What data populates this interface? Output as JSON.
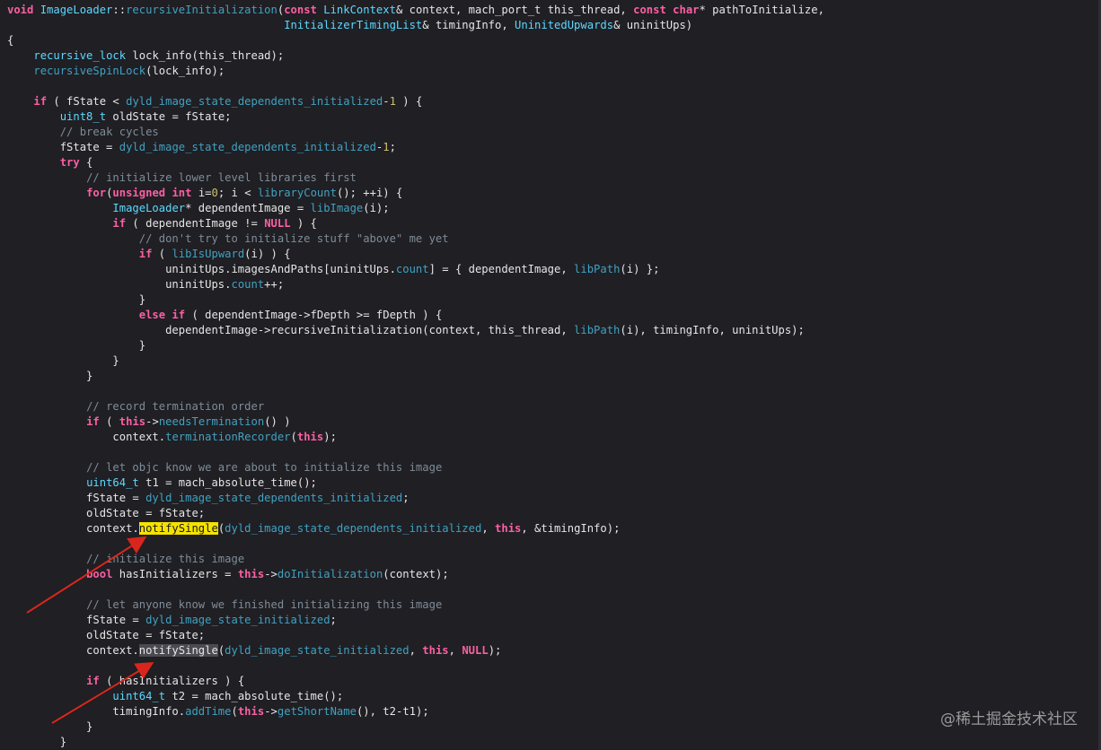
{
  "code_lines": [
    [
      [
        "void ",
        "kw"
      ],
      [
        "ImageLoader",
        "ty"
      ],
      [
        "::",
        "t"
      ],
      [
        "recursiveInitialization",
        "fn"
      ],
      [
        "(",
        "t"
      ],
      [
        "const ",
        "kw"
      ],
      [
        "LinkContext",
        "ty"
      ],
      [
        "& context, mach_port_t this_thread, ",
        "t"
      ],
      [
        "const ",
        "kw"
      ],
      [
        "char",
        "kw"
      ],
      [
        "* pathToInitialize,",
        "t"
      ]
    ],
    [
      [
        "                                          ",
        "t"
      ],
      [
        "InitializerTimingList",
        "ty"
      ],
      [
        "& timingInfo, ",
        "t"
      ],
      [
        "UninitedUpwards",
        "ty"
      ],
      [
        "& uninitUps)",
        "t"
      ]
    ],
    [
      [
        "{",
        "t"
      ]
    ],
    [
      [
        "    ",
        "t"
      ],
      [
        "recursive_lock",
        "ty"
      ],
      [
        " lock_info(this_thread);",
        "t"
      ]
    ],
    [
      [
        "    ",
        "t"
      ],
      [
        "recursiveSpinLock",
        "fn"
      ],
      [
        "(lock_info);",
        "t"
      ]
    ],
    [
      [
        "",
        "t"
      ]
    ],
    [
      [
        "    ",
        "t"
      ],
      [
        "if",
        "kw"
      ],
      [
        " ( fState < ",
        "t"
      ],
      [
        "dyld_image_state_dependents_initialized",
        "fn"
      ],
      [
        "-",
        "t"
      ],
      [
        "1",
        "nm"
      ],
      [
        " ) {",
        "t"
      ]
    ],
    [
      [
        "        ",
        "t"
      ],
      [
        "uint8_t",
        "ty"
      ],
      [
        " oldState = fState;",
        "t"
      ]
    ],
    [
      [
        "        ",
        "t"
      ],
      [
        "// break cycles",
        "cm"
      ]
    ],
    [
      [
        "        fState = ",
        "t"
      ],
      [
        "dyld_image_state_dependents_initialized",
        "fn"
      ],
      [
        "-",
        "t"
      ],
      [
        "1",
        "nm"
      ],
      [
        ";",
        "t"
      ]
    ],
    [
      [
        "        ",
        "t"
      ],
      [
        "try",
        "kw"
      ],
      [
        " {",
        "t"
      ]
    ],
    [
      [
        "            ",
        "t"
      ],
      [
        "// initialize lower level libraries first",
        "cm"
      ]
    ],
    [
      [
        "            ",
        "t"
      ],
      [
        "for",
        "kw"
      ],
      [
        "(",
        "t"
      ],
      [
        "unsigned int",
        "kw"
      ],
      [
        " i=",
        "t"
      ],
      [
        "0",
        "nm"
      ],
      [
        "; i < ",
        "t"
      ],
      [
        "libraryCount",
        "fn"
      ],
      [
        "(); ++i) {",
        "t"
      ]
    ],
    [
      [
        "                ",
        "t"
      ],
      [
        "ImageLoader",
        "ty"
      ],
      [
        "* dependentImage = ",
        "t"
      ],
      [
        "libImage",
        "fn"
      ],
      [
        "(i);",
        "t"
      ]
    ],
    [
      [
        "                ",
        "t"
      ],
      [
        "if",
        "kw"
      ],
      [
        " ( dependentImage != ",
        "t"
      ],
      [
        "NULL",
        "kw"
      ],
      [
        " ) {",
        "t"
      ]
    ],
    [
      [
        "                    ",
        "t"
      ],
      [
        "// don't try to initialize stuff \"above\" me yet",
        "cm"
      ]
    ],
    [
      [
        "                    ",
        "t"
      ],
      [
        "if",
        "kw"
      ],
      [
        " ( ",
        "t"
      ],
      [
        "libIsUpward",
        "fn"
      ],
      [
        "(i) ) {",
        "t"
      ]
    ],
    [
      [
        "                        uninitUps.imagesAndPaths[uninitUps.",
        "t"
      ],
      [
        "count",
        "fn"
      ],
      [
        "] = { dependentImage, ",
        "t"
      ],
      [
        "libPath",
        "fn"
      ],
      [
        "(i) };",
        "t"
      ]
    ],
    [
      [
        "                        uninitUps.",
        "t"
      ],
      [
        "count",
        "fn"
      ],
      [
        "++;",
        "t"
      ]
    ],
    [
      [
        "                    }",
        "t"
      ]
    ],
    [
      [
        "                    ",
        "t"
      ],
      [
        "else if",
        "kw"
      ],
      [
        " ( dependentImage->fDepth >= fDepth ) {",
        "t"
      ]
    ],
    [
      [
        "                        dependentImage->recursiveInitialization(context, this_thread, ",
        "t"
      ],
      [
        "libPath",
        "fn"
      ],
      [
        "(i), timingInfo, uninitUps);",
        "t"
      ]
    ],
    [
      [
        "                    }",
        "t"
      ]
    ],
    [
      [
        "                }",
        "t"
      ]
    ],
    [
      [
        "            }",
        "t"
      ]
    ],
    [
      [
        "",
        "t"
      ]
    ],
    [
      [
        "            ",
        "t"
      ],
      [
        "// record termination order",
        "cm"
      ]
    ],
    [
      [
        "            ",
        "t"
      ],
      [
        "if",
        "kw"
      ],
      [
        " ( ",
        "t"
      ],
      [
        "this",
        "kw"
      ],
      [
        "->",
        "t"
      ],
      [
        "needsTermination",
        "fn"
      ],
      [
        "() )",
        "t"
      ]
    ],
    [
      [
        "                context.",
        "t"
      ],
      [
        "terminationRecorder",
        "fn"
      ],
      [
        "(",
        "t"
      ],
      [
        "this",
        "kw"
      ],
      [
        ");",
        "t"
      ]
    ],
    [
      [
        "",
        "t"
      ]
    ],
    [
      [
        "            ",
        "t"
      ],
      [
        "// let objc know we are about to initialize this image",
        "cm"
      ]
    ],
    [
      [
        "            ",
        "t"
      ],
      [
        "uint64_t",
        "ty"
      ],
      [
        " t1 = mach_absolute_time();",
        "t"
      ]
    ],
    [
      [
        "            fState = ",
        "t"
      ],
      [
        "dyld_image_state_dependents_initialized",
        "fn"
      ],
      [
        ";",
        "t"
      ]
    ],
    [
      [
        "            oldState = fState;",
        "t"
      ]
    ],
    [
      [
        "            context.",
        "t"
      ],
      [
        "notifySingle",
        "hl-yellow"
      ],
      [
        "(",
        "t"
      ],
      [
        "dyld_image_state_dependents_initialized",
        "fn"
      ],
      [
        ", ",
        "t"
      ],
      [
        "this",
        "kw"
      ],
      [
        ", &timingInfo);",
        "t"
      ]
    ],
    [
      [
        "",
        "t"
      ]
    ],
    [
      [
        "            ",
        "t"
      ],
      [
        "// initialize this image",
        "cm"
      ]
    ],
    [
      [
        "            ",
        "t"
      ],
      [
        "bool",
        "kw"
      ],
      [
        " hasInitializers = ",
        "t"
      ],
      [
        "this",
        "kw"
      ],
      [
        "->",
        "t"
      ],
      [
        "doInitialization",
        "fn"
      ],
      [
        "(context);",
        "t"
      ]
    ],
    [
      [
        "",
        "t"
      ]
    ],
    [
      [
        "            ",
        "t"
      ],
      [
        "// let anyone know we finished initializing this image",
        "cm"
      ]
    ],
    [
      [
        "            fState = ",
        "t"
      ],
      [
        "dyld_image_state_initialized",
        "fn"
      ],
      [
        ";",
        "t"
      ]
    ],
    [
      [
        "            oldState = fState;",
        "t"
      ]
    ],
    [
      [
        "            context.",
        "t"
      ],
      [
        "notifySingle",
        "hl-gray"
      ],
      [
        "(",
        "t"
      ],
      [
        "dyld_image_state_initialized",
        "fn"
      ],
      [
        ", ",
        "t"
      ],
      [
        "this",
        "kw"
      ],
      [
        ", ",
        "t"
      ],
      [
        "NULL",
        "kw"
      ],
      [
        ");",
        "t"
      ]
    ],
    [
      [
        "",
        "t"
      ]
    ],
    [
      [
        "            ",
        "t"
      ],
      [
        "if",
        "kw"
      ],
      [
        " ( hasInitializers ) {",
        "t"
      ]
    ],
    [
      [
        "                ",
        "t"
      ],
      [
        "uint64_t",
        "ty"
      ],
      [
        " t2 = mach_absolute_time();",
        "t"
      ]
    ],
    [
      [
        "                timingInfo.",
        "t"
      ],
      [
        "addTime",
        "fn"
      ],
      [
        "(",
        "t"
      ],
      [
        "this",
        "kw"
      ],
      [
        "->",
        "t"
      ],
      [
        "getShortName",
        "fn"
      ],
      [
        "(), t2-t1);",
        "t"
      ]
    ],
    [
      [
        "            }",
        "t"
      ]
    ],
    [
      [
        "        }",
        "t"
      ]
    ]
  ],
  "watermark": "@稀土掘金技术社区",
  "colors": {
    "background": "#1f1f24",
    "keyword": "#fc5fa3",
    "type": "#5dd8ff",
    "function": "#41a1c0",
    "number": "#d0bf69",
    "comment": "#7f8c98",
    "highlight": "#f5e200",
    "arrow": "#d9261c"
  }
}
